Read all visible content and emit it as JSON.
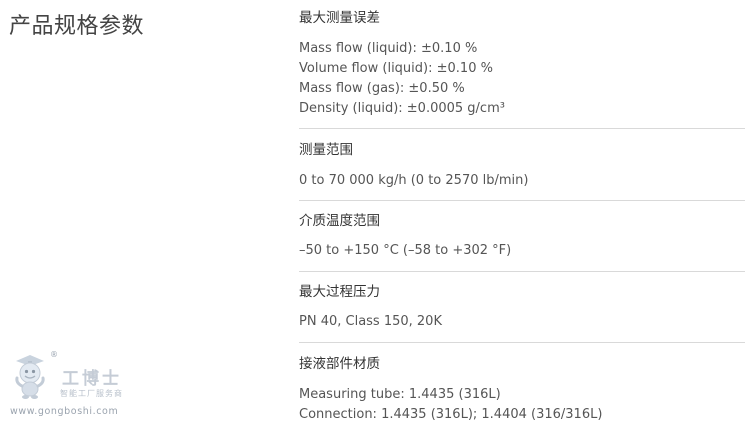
{
  "page_title": "产品规格参数",
  "sections": [
    {
      "heading": "最大测量误差",
      "lines": [
        "Mass flow (liquid): ±0.10 %",
        "Volume flow (liquid): ±0.10 %",
        "Mass flow (gas): ±0.50 %",
        "Density (liquid): ±0.0005 g/cm³"
      ]
    },
    {
      "heading": "测量范围",
      "lines": [
        "0 to 70 000 kg/h (0 to 2570 lb/min)"
      ]
    },
    {
      "heading": "介质温度范围",
      "lines": [
        "–50 to +150 °C (–58 to +302 °F)"
      ]
    },
    {
      "heading": "最大过程压力",
      "lines": [
        "PN 40, Class 150, 20K"
      ]
    },
    {
      "heading": "接液部件材质",
      "lines": [
        "Measuring tube: 1.4435 (316L)",
        "Connection: 1.4435 (316L); 1.4404 (316/316L)"
      ]
    }
  ],
  "watermark": {
    "registered": "®",
    "name": "工博士",
    "tagline": "智能工厂服务商",
    "url": "www.gongboshi.com"
  }
}
